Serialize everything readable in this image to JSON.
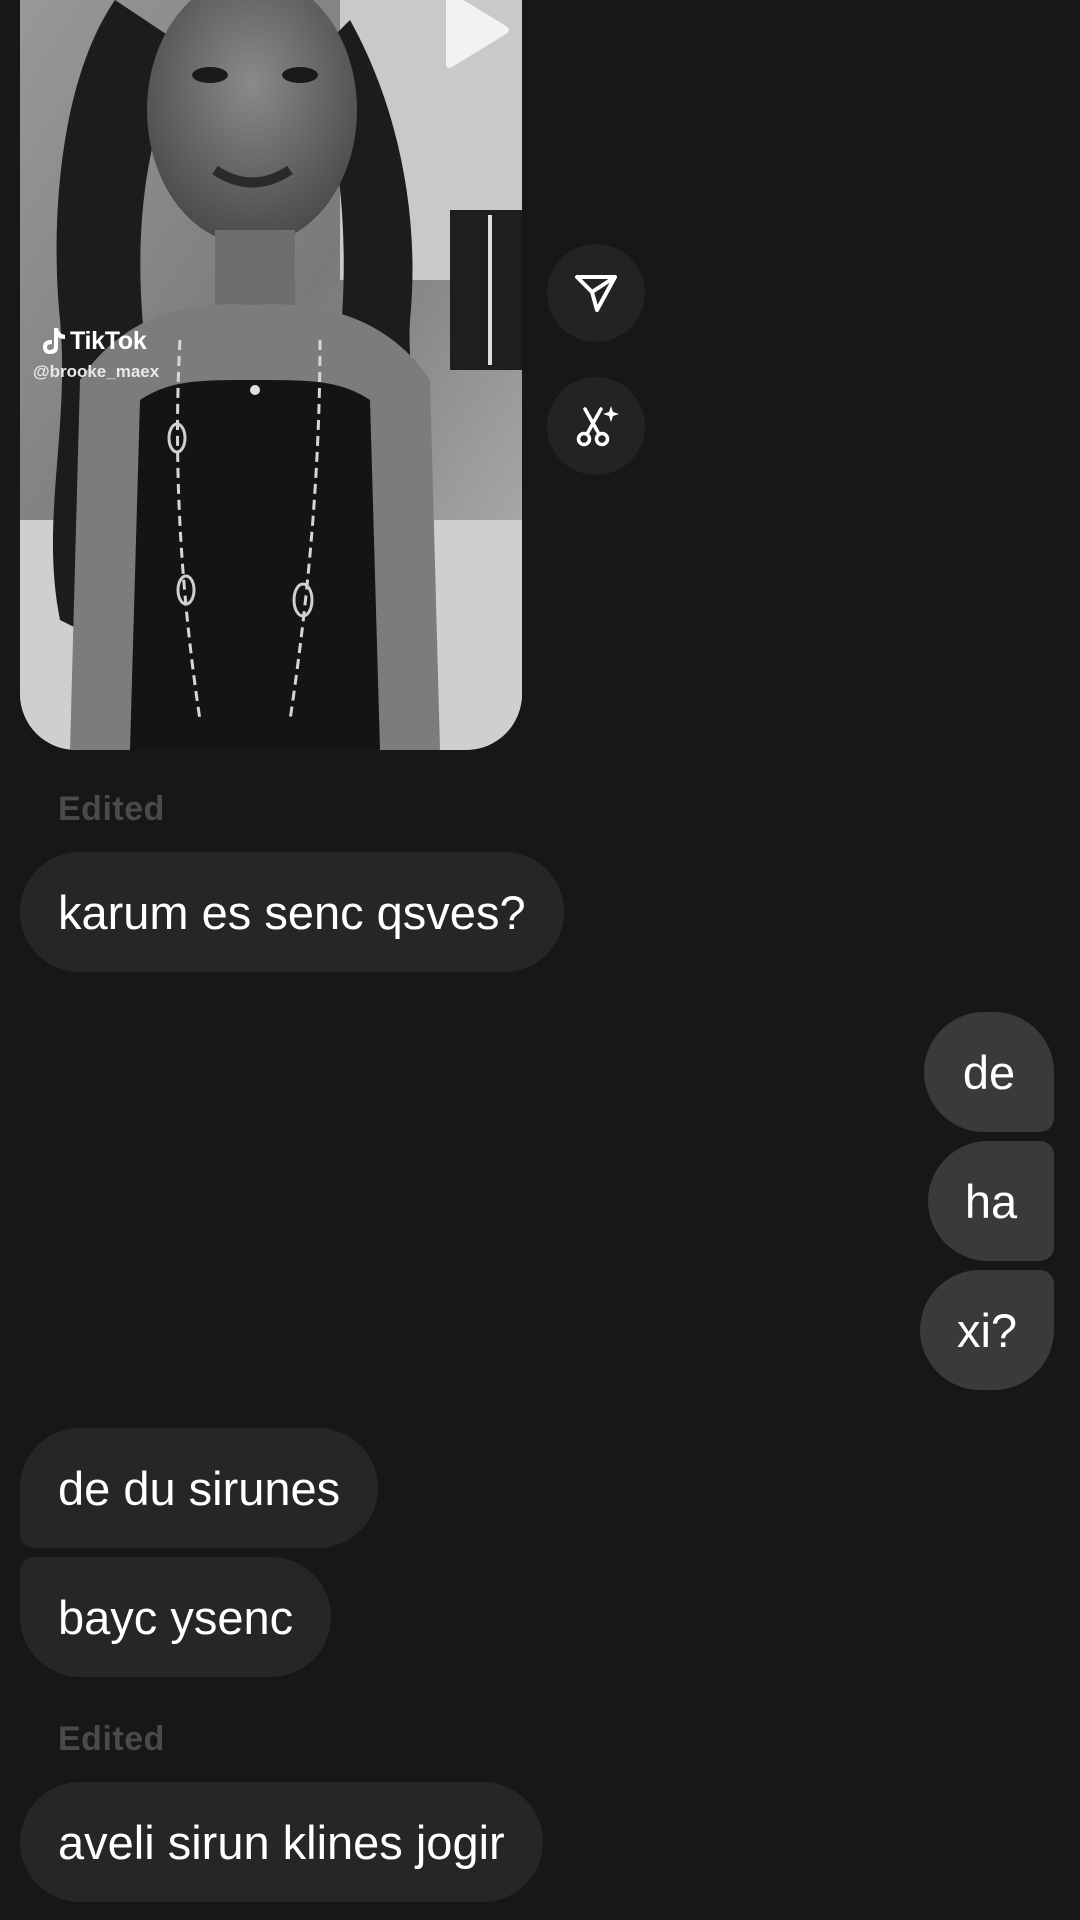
{
  "shared_post": {
    "platform": "TikTok",
    "handle": "@brooke_maex",
    "icons": {
      "play": "play-icon",
      "platform_logo": "tiktok-note-icon"
    }
  },
  "side_actions": [
    {
      "icon": "paper-plane-share-icon"
    },
    {
      "icon": "scissors-sparkle-icon"
    }
  ],
  "messages": [
    {
      "meta": "Edited"
    },
    {
      "from": "them",
      "text": "karum es senc qsves?"
    },
    {
      "from": "me",
      "text": "de"
    },
    {
      "from": "me",
      "text": "ha"
    },
    {
      "from": "me",
      "text": "xi?"
    },
    {
      "from": "them",
      "text": "de du sirunes"
    },
    {
      "from": "them",
      "text": "bayc ysenc"
    },
    {
      "meta": "Edited"
    },
    {
      "from": "them",
      "text": "aveli sirun klines jogir"
    }
  ],
  "colors": {
    "background": "#171618",
    "incoming_bubble": "#262528",
    "outgoing_bubble": "#3a393c",
    "meta_text": "#4a494c",
    "action_button": "#232224"
  }
}
